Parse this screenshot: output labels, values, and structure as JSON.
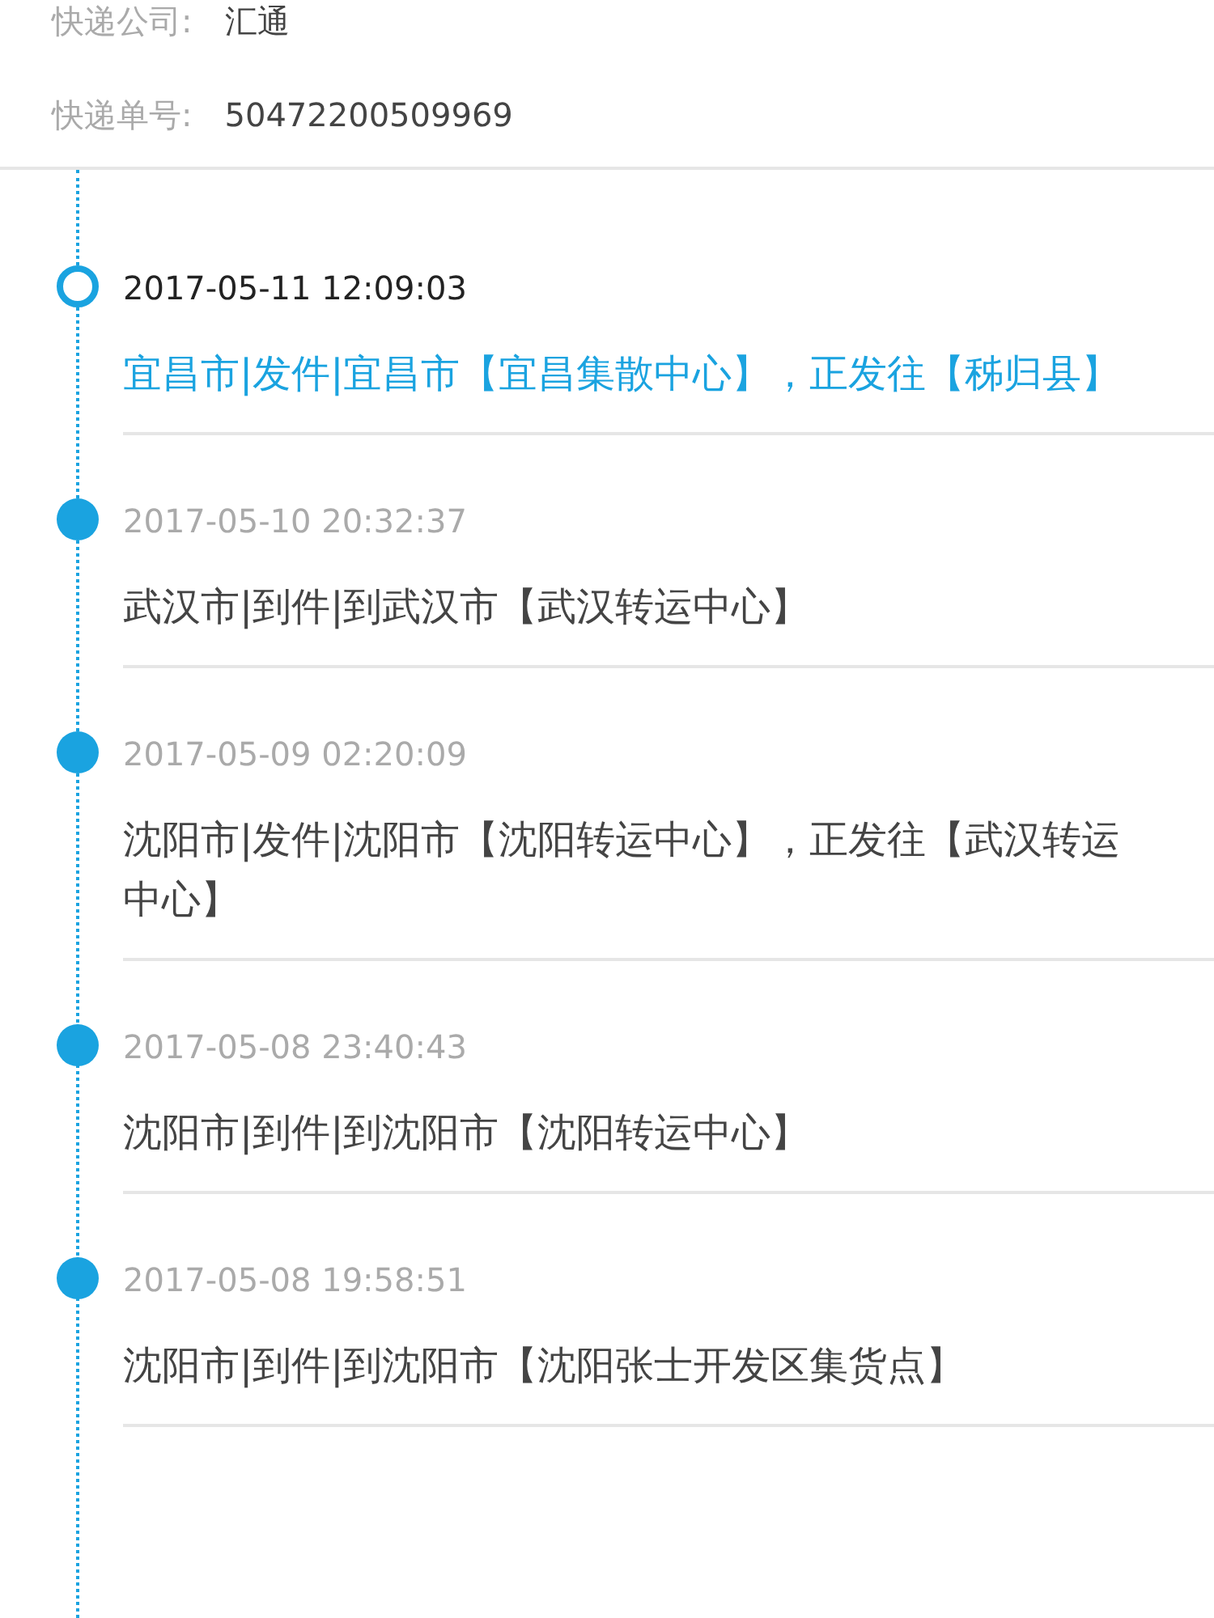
{
  "info": [
    {
      "label": "快递公司:",
      "value": "汇通"
    },
    {
      "label": "快递单号:",
      "value": "50472200509969"
    }
  ],
  "events": [
    {
      "time": "2017-05-11 12:09:03",
      "description": "宜昌市|发件|宜昌市【宜昌集散中心】，正发往【秭归县】",
      "current": true
    },
    {
      "time": "2017-05-10 20:32:37",
      "description": "武汉市|到件|到武汉市【武汉转运中心】",
      "current": false
    },
    {
      "time": "2017-05-09 02:20:09",
      "description": "沈阳市|发件|沈阳市【沈阳转运中心】，正发往【武汉转运中心】",
      "current": false
    },
    {
      "time": "2017-05-08 23:40:43",
      "description": "沈阳市|到件|到沈阳市【沈阳转运中心】",
      "current": false
    },
    {
      "time": "2017-05-08 19:58:51",
      "description": "沈阳市|到件|到沈阳市【沈阳张士开发区集货点】",
      "current": false
    }
  ]
}
